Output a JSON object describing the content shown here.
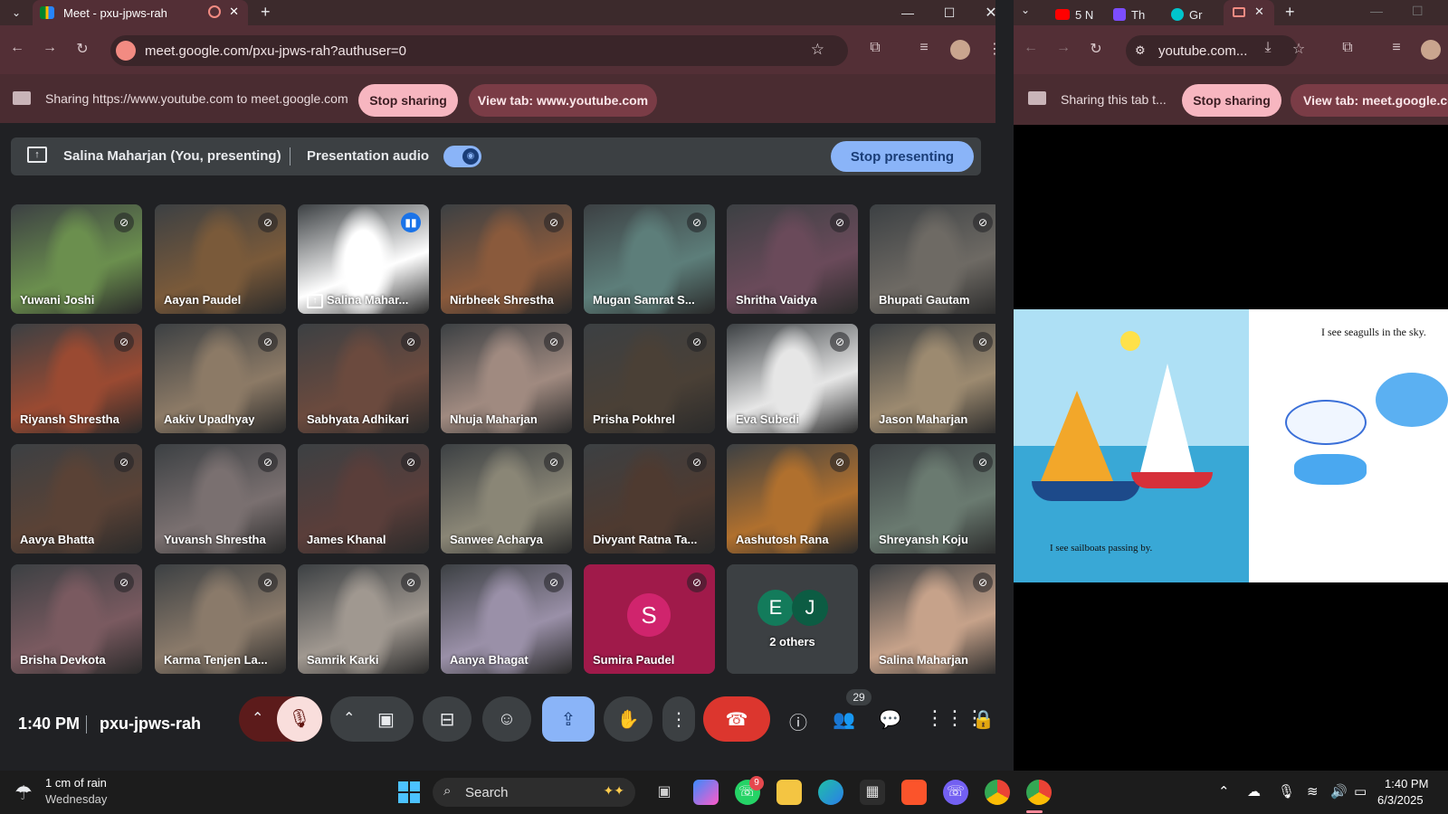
{
  "left_window": {
    "tab_title": "Meet - pxu-jpws-rah",
    "url": "meet.google.com/pxu-jpws-rah?authuser=0",
    "share_bar": {
      "text": "Sharing https://www.youtube.com to meet.google.com",
      "stop_label": "Stop sharing",
      "view_label": "View tab: www.youtube.com"
    }
  },
  "meet": {
    "presenter_label": "Salina Maharjan (You, presenting)",
    "presentation_audio_label": "Presentation audio",
    "presentation_audio_on": true,
    "stop_presenting_label": "Stop presenting",
    "tiles": [
      {
        "name": "Yuwani Joshi",
        "color": "#6b8f4e",
        "muted": true
      },
      {
        "name": "Aayan Paudel",
        "color": "#7a5a3a",
        "muted": true
      },
      {
        "name": "Salina Mahar...",
        "color": "#ffffff",
        "muted": false,
        "presenting": true
      },
      {
        "name": "Nirbheek Shrestha",
        "color": "#8a5a3c",
        "muted": true
      },
      {
        "name": "Mugan Samrat S...",
        "color": "#5d7e7a",
        "muted": true
      },
      {
        "name": "Shritha Vaidya",
        "color": "#6a4a5a",
        "muted": true
      },
      {
        "name": "Bhupati Gautam",
        "color": "#6e6a64",
        "muted": true
      },
      {
        "name": "Riyansh Shrestha",
        "color": "#9a4a32",
        "muted": true
      },
      {
        "name": "Aakiv Upadhyay",
        "color": "#8c7a66",
        "muted": true
      },
      {
        "name": "Sabhyata Adhikari",
        "color": "#6b4a3e",
        "muted": true
      },
      {
        "name": "Nhuja Maharjan",
        "color": "#a08a80",
        "muted": true
      },
      {
        "name": "Prisha Pokhrel",
        "color": "#4a4036",
        "muted": true
      },
      {
        "name": "Eva Subedi",
        "color": "#e6e6e6",
        "muted": true
      },
      {
        "name": "Jason Maharjan",
        "color": "#9c8a70",
        "muted": true
      },
      {
        "name": "Aavya Bhatta",
        "color": "#5a4236",
        "muted": true
      },
      {
        "name": "Yuvansh Shrestha",
        "color": "#7a7070",
        "muted": true
      },
      {
        "name": "James Khanal",
        "color": "#5a3e3a",
        "muted": true
      },
      {
        "name": "Sanwee Acharya",
        "color": "#8a8676",
        "muted": true
      },
      {
        "name": "Divyant Ratna Ta...",
        "color": "#4e3a30",
        "muted": true
      },
      {
        "name": "Aashutosh Rana",
        "color": "#b0702e",
        "muted": true
      },
      {
        "name": "Shreyansh Koju",
        "color": "#6a7a70",
        "muted": true
      },
      {
        "name": "Brisha Devkota",
        "color": "#7a5a60",
        "muted": true
      },
      {
        "name": "Karma Tenjen La...",
        "color": "#8a7a6a",
        "muted": true
      },
      {
        "name": "Samrik Karki",
        "color": "#a09890",
        "muted": true
      },
      {
        "name": "Aanya Bhagat",
        "color": "#9a90a8",
        "muted": true
      },
      {
        "name": "Sumira Paudel",
        "color": "#a01a4a",
        "muted": true,
        "avatar": "S"
      },
      {
        "name": "2 others",
        "color": "#3c4043",
        "muted": false,
        "others": [
          "E",
          "J"
        ]
      },
      {
        "name": "Salina Maharjan",
        "color": "#c6a28a",
        "muted": true
      }
    ],
    "bottom": {
      "time": "1:40 PM",
      "meeting_code": "pxu-jpws-rah",
      "participant_count": "29"
    }
  },
  "right_window": {
    "tabs": [
      "5 N",
      "Th",
      "Gr"
    ],
    "url": "youtube.com...",
    "share_bar": {
      "text": "Sharing this tab t...",
      "stop_label": "Stop sharing",
      "view_label": "View tab: meet.google.com"
    },
    "video": {
      "caption_left": "I see sailboats passing by.",
      "caption_right": "I see seagulls in the sky."
    }
  },
  "taskbar": {
    "weather_main": "1 cm of rain",
    "weather_sub": "Wednesday",
    "search_label": "Search",
    "whatsapp_badge": "9",
    "time": "1:40 PM",
    "date": "6/3/2025"
  }
}
